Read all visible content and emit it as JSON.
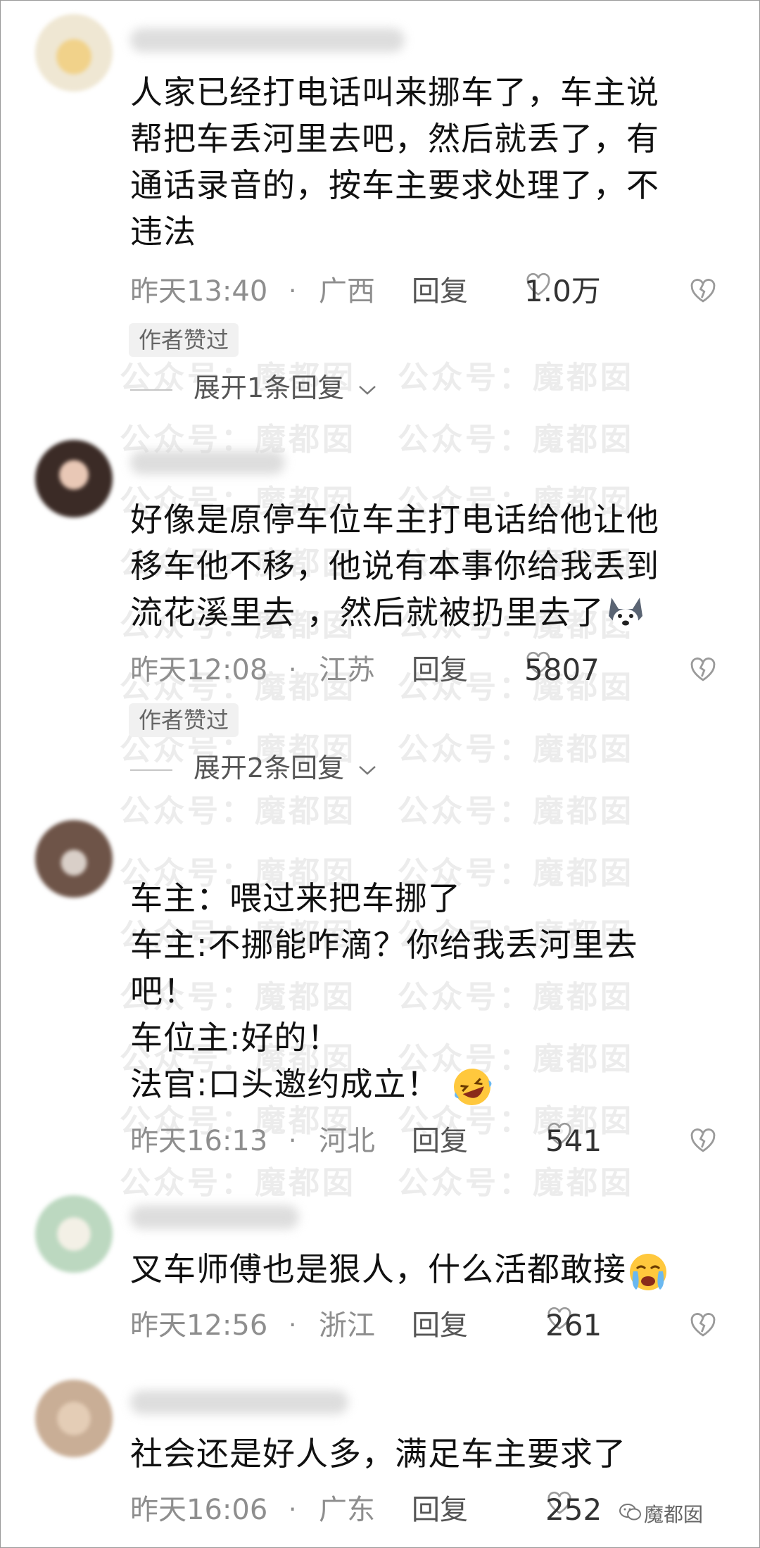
{
  "watermark": "公众号：魔都囡",
  "brand": "魔都囡",
  "comments": [
    {
      "lines": [
        "人家已经打电话叫来挪车了，车主说",
        "帮把车丢河里去吧，然后就丢了，有",
        "通话录音的，按车主要求处理了，不",
        "违法"
      ],
      "time": "昨天13:40",
      "location": "广西",
      "reply": "回复",
      "likes": "1.0万",
      "tag": "作者赞过",
      "expand": "展开1条回复"
    },
    {
      "lines": [
        "好像是原停车位车主打电话给他让他",
        "移车他不移，他说有本事你给我丢到",
        "流花溪里去 ，然后就被扔里去了"
      ],
      "time": "昨天12:08",
      "location": "江苏",
      "reply": "回复",
      "likes": "5807",
      "tag": "作者赞过",
      "expand": "展开2条回复"
    },
    {
      "lines": [
        "车主：喂过来把车挪了",
        "车主:不挪能咋滴？你给我丢河里去",
        "吧！",
        "车位主:好的！",
        "法官:口头邀约成立！"
      ],
      "time": "昨天16:13",
      "location": "河北",
      "reply": "回复",
      "likes": "541"
    },
    {
      "lines": [
        "叉车师傅也是狠人，什么活都敢接"
      ],
      "time": "昨天12:56",
      "location": "浙江",
      "reply": "回复",
      "likes": "261"
    },
    {
      "lines": [
        "社会还是好人多，满足车主要求了"
      ],
      "time": "昨天16:06",
      "location": "广东",
      "reply": "回复",
      "likes": "252"
    }
  ],
  "colors": {
    "text": "#111111",
    "meta": "#8e8e8e",
    "tag_bg": "#f1f1f1"
  },
  "icons": [
    "heart-outline-icon",
    "dislike-broken-heart-icon",
    "chevron-down-icon",
    "husky-emoji-icon",
    "laughing-crying-emoji-icon",
    "crying-face-emoji-icon",
    "wechat-icon"
  ]
}
